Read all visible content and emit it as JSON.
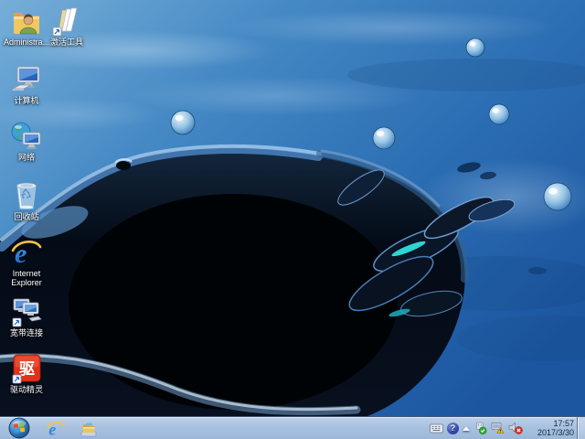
{
  "desktop": {
    "icons": [
      {
        "label": "Administra...",
        "icon": "user-folder-icon"
      },
      {
        "label": "激活工具",
        "icon": "open-folder-shortcut-icon"
      },
      {
        "label": "计算机",
        "icon": "computer-icon"
      },
      {
        "label": "网络",
        "icon": "network-icon"
      },
      {
        "label": "回收站",
        "icon": "recycle-bin-icon"
      },
      {
        "label": "Internet Explorer",
        "icon": "internet-explorer-icon"
      },
      {
        "label": "宽带连接",
        "icon": "broadband-connection-shortcut-icon"
      },
      {
        "label": "驱动精灵",
        "icon": "driver-genius-shortcut-icon"
      }
    ],
    "driver_glyph": "驱"
  },
  "taskbar": {
    "pinned": [
      {
        "name": "internet-explorer"
      },
      {
        "name": "windows-explorer"
      }
    ],
    "tray": {
      "icons": [
        "keyboard",
        "help-question",
        "show-hidden-icons",
        "hardware-ok",
        "network-warning",
        "volume-muted"
      ],
      "clock": {
        "time": "17:57",
        "date": "2017/3/30"
      },
      "help_glyph": "?"
    }
  },
  "colors": {
    "taskbar": "#a9c2e0",
    "desktop_blue_light": "#76aed8",
    "desktop_blue_deep": "#1c55a0",
    "splash_dark": "#04090f",
    "teal_accent": "#2ee0dc",
    "driver_red": "#e23119",
    "warning_yellow": "#f5c518",
    "mute_red": "#d93025"
  }
}
